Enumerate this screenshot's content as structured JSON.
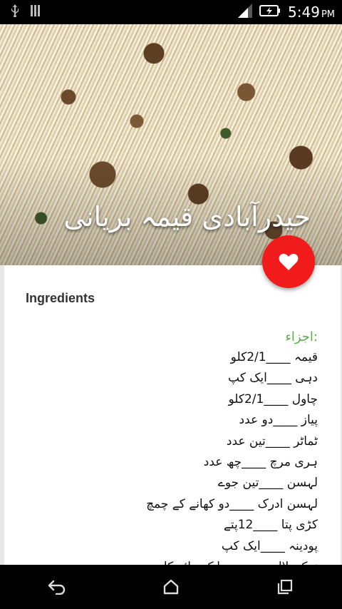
{
  "status_bar": {
    "time": "5:49",
    "ampm": "PM",
    "icons": [
      "usb-icon",
      "sim-icon",
      "signal-icon",
      "battery-charging-icon"
    ]
  },
  "hero": {
    "title": "حیدرآبادی قیمہ بریانی"
  },
  "favorite_button": {
    "icon": "heart-icon",
    "color": "#f21b1b"
  },
  "card": {
    "heading": "Ingredients",
    "list_label": ":اجزاء",
    "items": [
      "قیمہ ____2/1کلو",
      "دہی ____ایک کپ",
      "چاول ____2/1کلو",
      "پیاز ____دو عدد",
      "ٹماٹر ____تین عدد",
      "ہری مرچ ____چھ عدد",
      "لہسن ____تین جوے",
      "لہسن ادرک ____دو کھانے کے چمچ",
      "کڑی پتا ____12پتے",
      "پودینہ ____ایک کپ",
      "نمک ،لال مرچ ____ایک چائے کا چمچ"
    ]
  },
  "navigation": {
    "icons": [
      "back-icon",
      "home-icon",
      "recents-icon"
    ]
  }
}
